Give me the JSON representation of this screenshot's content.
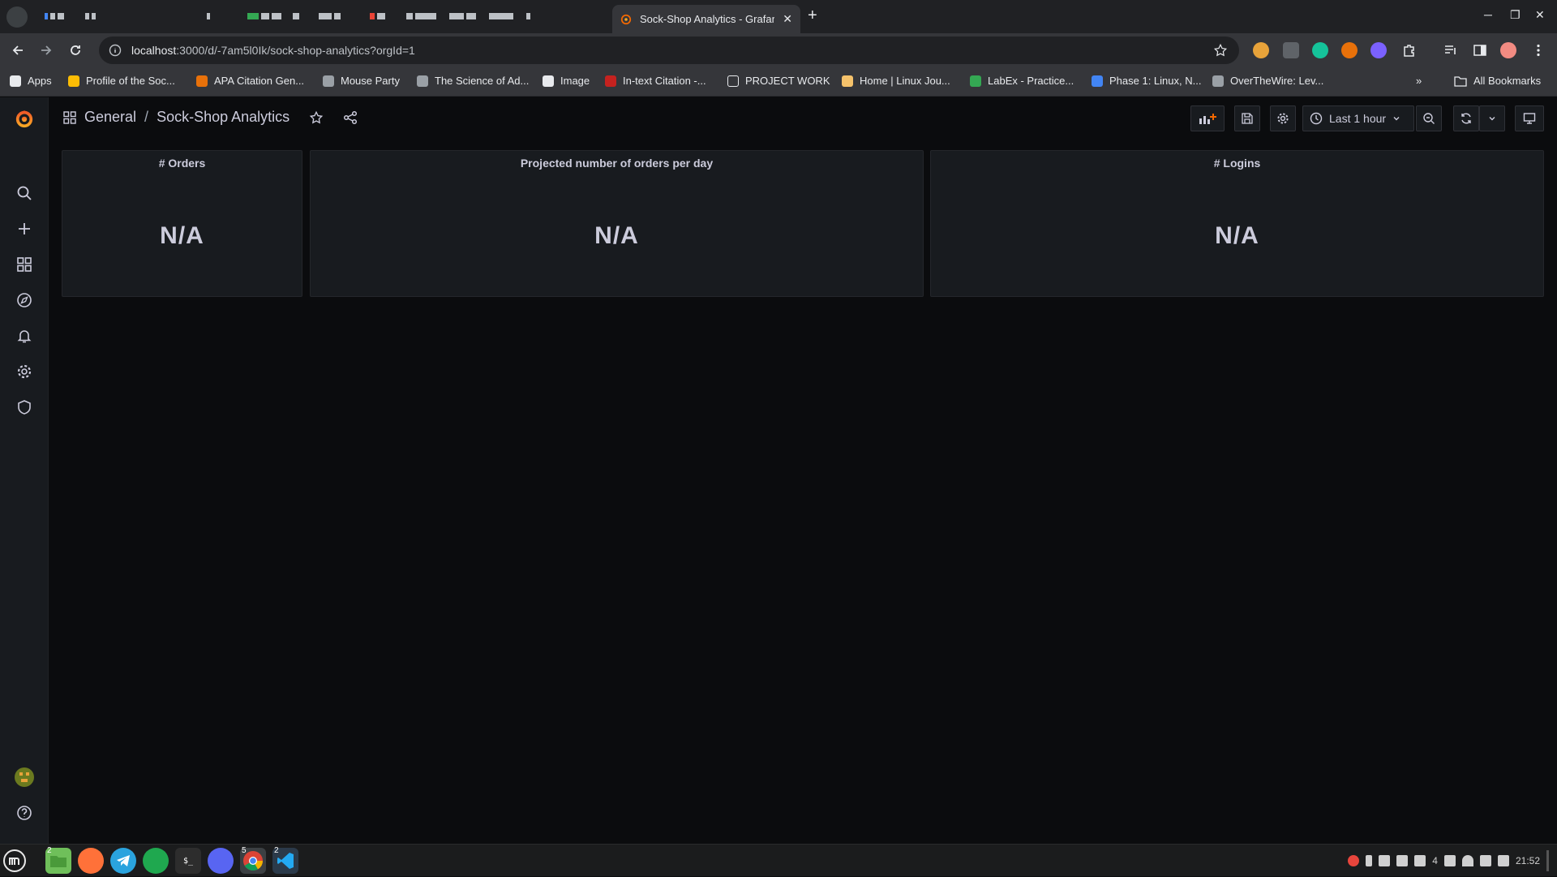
{
  "browser": {
    "active_tab_title": "Sock-Shop Analytics - Grafan",
    "url_host": "localhost",
    "url_path": ":3000/d/-7am5l0Ik/sock-shop-analytics?orgId=1",
    "bookmarks": [
      {
        "label": "Apps",
        "icon": "apps-grid-icon",
        "color": "#e8eaed"
      },
      {
        "label": "Profile of the Soc...",
        "icon": "emoji-face-icon",
        "color": "#fbbc04"
      },
      {
        "label": "APA Citation Gen...",
        "icon": "apa-icon",
        "color": "#e8710a"
      },
      {
        "label": "Mouse Party",
        "icon": "mouse-icon",
        "color": "#9aa0a6"
      },
      {
        "label": "The Science of Ad...",
        "icon": "science-icon",
        "color": "#9aa0a6"
      },
      {
        "label": "Image",
        "icon": "globe-icon",
        "color": "#e8eaed"
      },
      {
        "label": "In-text Citation -...",
        "icon": "citation-icon",
        "color": "#c5221f"
      },
      {
        "label": "PROJECT WORK",
        "icon": "folder-icon",
        "color": "#e8eaed"
      },
      {
        "label": "Home | Linux Jou...",
        "icon": "linux-icon",
        "color": "#f5c26b"
      },
      {
        "label": "LabEx - Practice...",
        "icon": "labex-icon",
        "color": "#34a853"
      },
      {
        "label": "Phase 1: Linux, N...",
        "icon": "phase-icon",
        "color": "#4285f4"
      },
      {
        "label": "OverTheWire: Lev...",
        "icon": "overthewire-icon",
        "color": "#9aa0a6"
      }
    ],
    "all_bookmarks": "All Bookmarks"
  },
  "dashboard": {
    "folder": "General",
    "separator": "/",
    "title": "Sock-Shop Analytics",
    "time_range": "Last 1 hour",
    "accent_color": "#f46800"
  },
  "panels": [
    {
      "title": "# Orders",
      "value": "N/A"
    },
    {
      "title": "Projected number of orders per day",
      "value": "N/A"
    },
    {
      "title": "# Logins",
      "value": "N/A"
    }
  ],
  "taskbar": {
    "time": "21:52",
    "badges": {
      "files": "2",
      "chrome": "5",
      "vscode": "2"
    },
    "tray_count": "4"
  }
}
